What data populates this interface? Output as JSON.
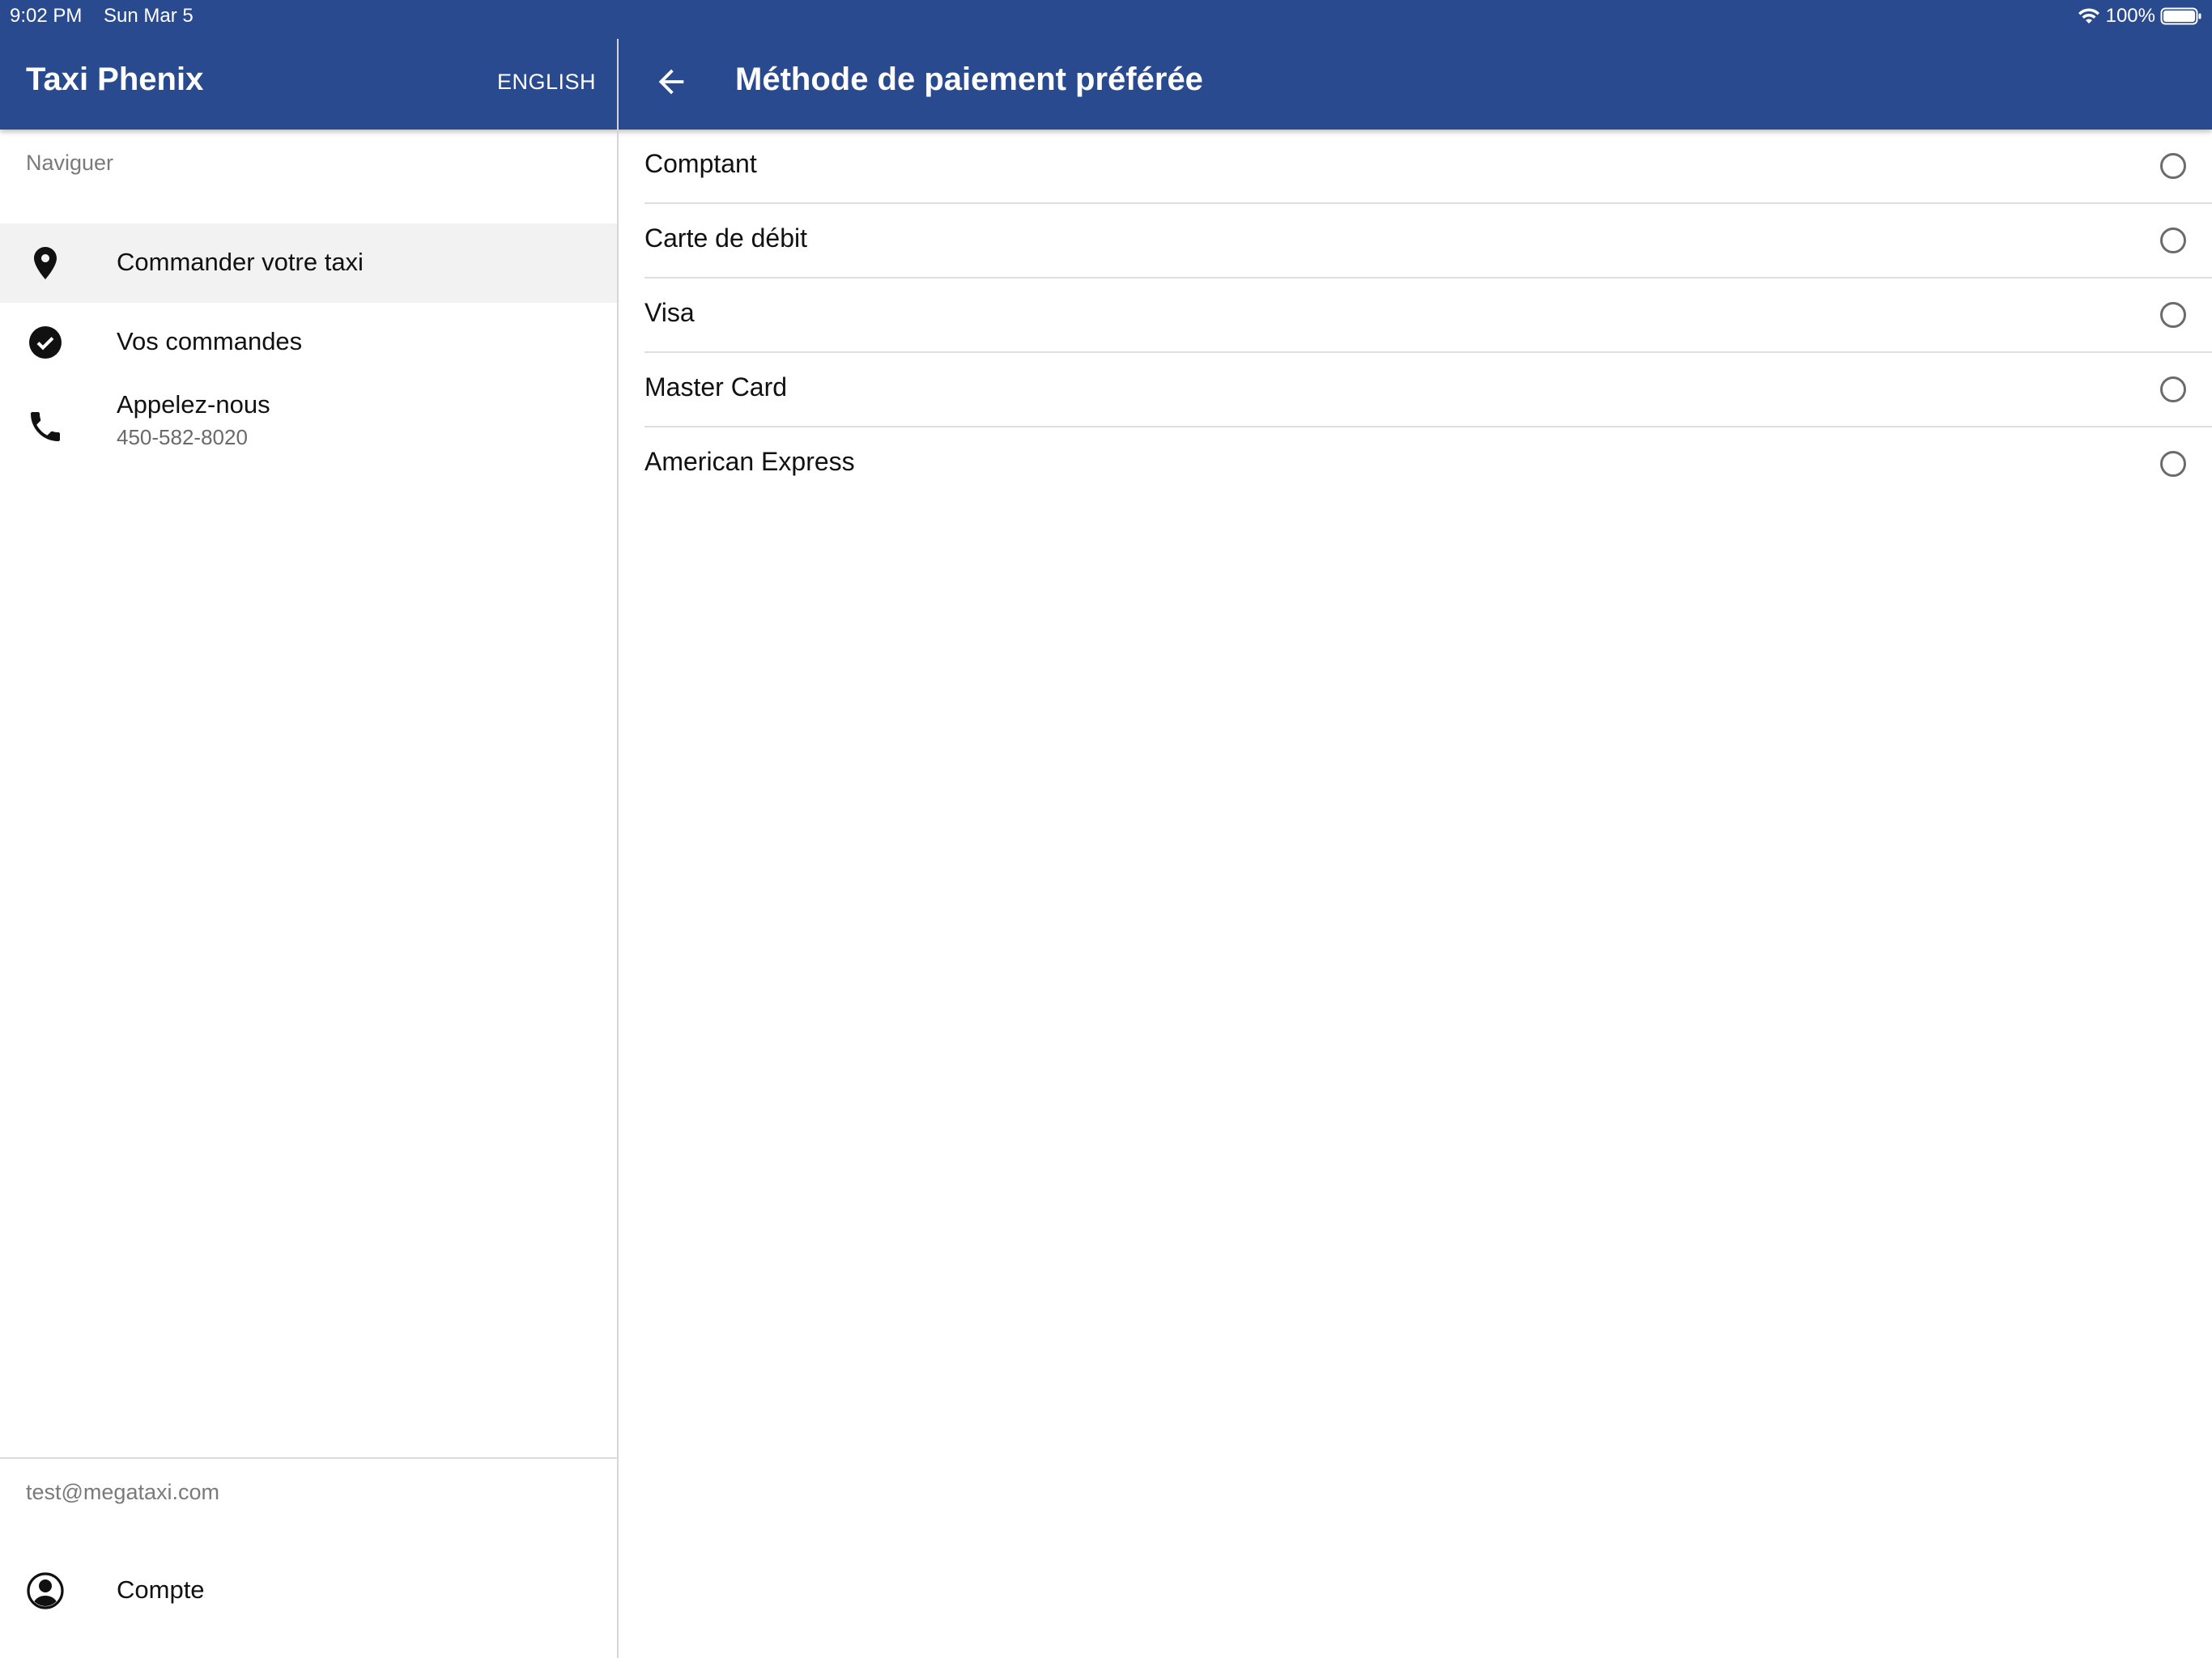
{
  "status_bar": {
    "time": "9:02 PM",
    "date": "Sun Mar 5",
    "battery": "100%"
  },
  "sidebar": {
    "app_title": "Taxi Phenix",
    "language_button": "ENGLISH",
    "section_header": "Naviguer",
    "items": [
      {
        "label": "Commander votre taxi",
        "icon": "location-pin-icon",
        "active": true
      },
      {
        "label": "Vos commandes",
        "icon": "check-circle-icon",
        "active": false
      },
      {
        "label": "Appelez-nous",
        "sublabel": "450-582-8020",
        "icon": "phone-icon",
        "active": false
      }
    ],
    "account_email": "test@megataxi.com",
    "account_item": {
      "label": "Compte",
      "icon": "account-circle-icon"
    }
  },
  "main": {
    "title": "Méthode de paiement préférée",
    "back_icon": "arrow-back-icon",
    "options": [
      {
        "label": "Comptant",
        "selected": false
      },
      {
        "label": "Carte de débit",
        "selected": false
      },
      {
        "label": "Visa",
        "selected": false
      },
      {
        "label": "Master Card",
        "selected": false
      },
      {
        "label": "American Express",
        "selected": false
      }
    ]
  },
  "colors": {
    "header_blue": "#2a4a90",
    "active_item_bg": "#f2f2f2"
  }
}
